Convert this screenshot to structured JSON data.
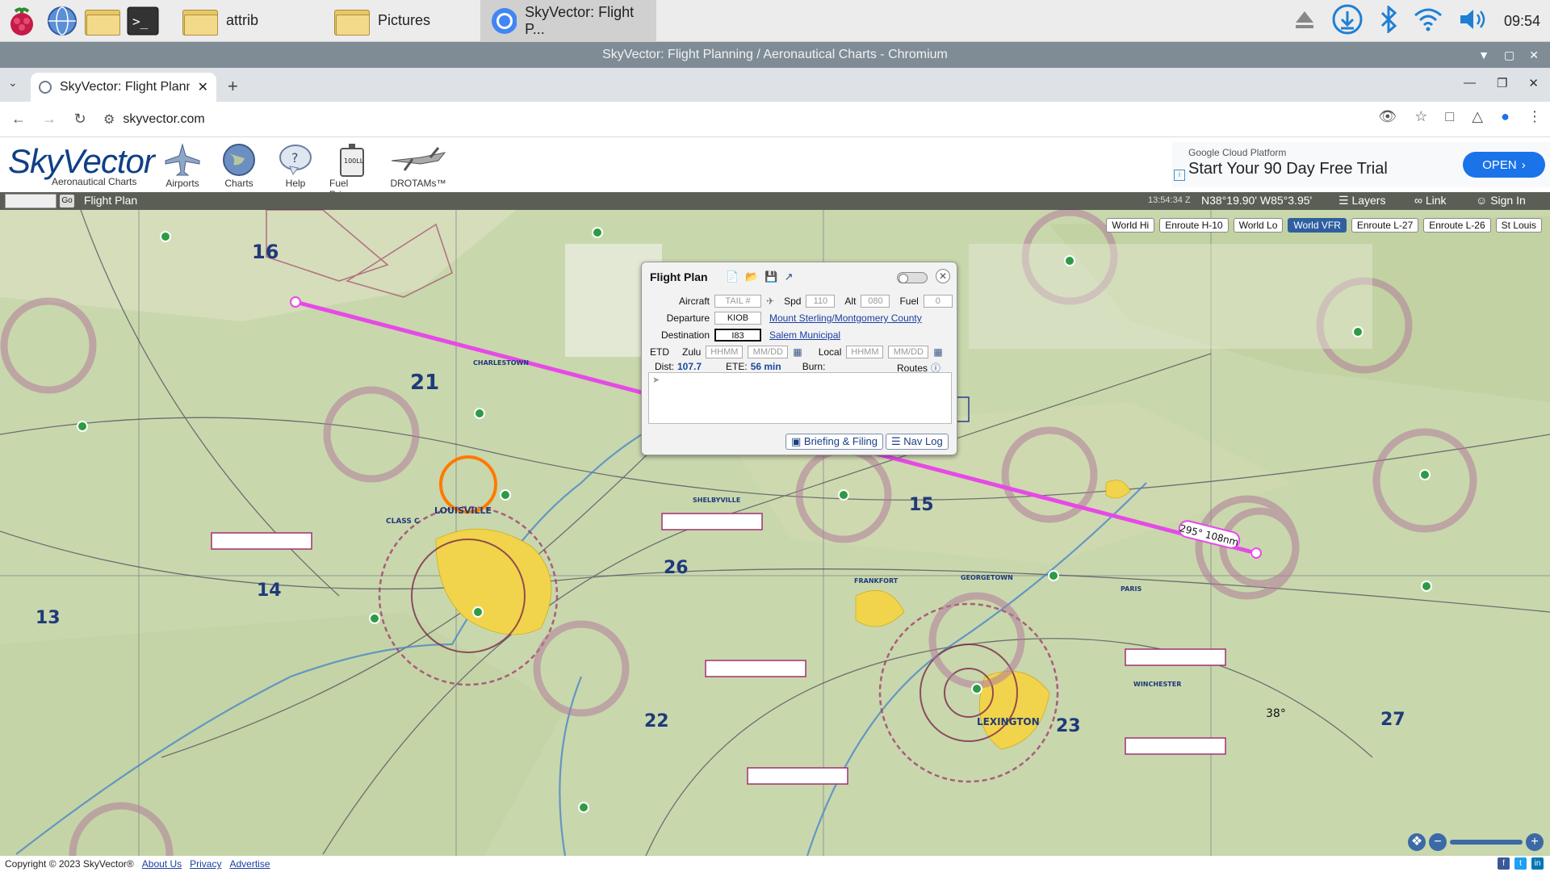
{
  "taskbar": {
    "items": [
      {
        "label": "attrib"
      },
      {
        "label": "Pictures"
      },
      {
        "label": "SkyVector: Flight P..."
      }
    ],
    "clock": "09:54"
  },
  "window": {
    "title": "SkyVector: Flight Planning / Aeronautical Charts - Chromium"
  },
  "browser": {
    "tab_title": "SkyVector: Flight Planning",
    "url": "skyvector.com"
  },
  "header": {
    "logo": "SkyVector",
    "logo_sub": "Aeronautical Charts",
    "nav": [
      "Airports",
      "Charts",
      "Help",
      "Fuel Prices",
      "DROTAMs™"
    ],
    "ad": {
      "provider": "Google Cloud Platform",
      "headline": "Start Your 90 Day Free Trial",
      "button": "OPEN"
    }
  },
  "map": {
    "go_label": "Go",
    "flight_plan_label": "Flight Plan",
    "time": "13:54:34 Z",
    "coords": "N38°19.90' W85°3.95'",
    "layers": "Layers",
    "link": "Link",
    "sign_in": "Sign In",
    "chart_tabs": [
      "World Hi",
      "Enroute H-10",
      "World Lo",
      "World VFR",
      "Enroute L-27",
      "Enroute L-26",
      "St Louis"
    ],
    "selected_chart": "World VFR",
    "route_label": "295° 108nm",
    "labels": [
      "LOUISVILLE",
      "LEXINGTON",
      "CHARLESTOWN",
      "SHELBYVILLE",
      "FRANKFORT",
      "WINCHESTER",
      "PARIS",
      "GEORGETOWN",
      "CLASS C",
      "16",
      "21",
      "14",
      "13",
      "26",
      "15",
      "22",
      "23",
      "27",
      "38°"
    ]
  },
  "flight_plan": {
    "title": "Flight Plan",
    "aircraft_label": "Aircraft",
    "tail_placeholder": "TAIL #",
    "spd_label": "Spd",
    "spd_value": "110",
    "alt_label": "Alt",
    "alt_value": "080",
    "fuel_label": "Fuel",
    "fuel_value": "0",
    "departure_label": "Departure",
    "departure_code": "KIOB",
    "departure_name": "Mount Sterling/Montgomery County",
    "destination_label": "Destination",
    "destination_code": "I83",
    "destination_name": "Salem Municipal",
    "etd_label": "ETD",
    "zulu_label": "Zulu",
    "local_label": "Local",
    "hhmm": "HHMM",
    "mmdd": "MM/DD",
    "dist_label": "Dist:",
    "dist_value": "107.7",
    "ete_label": "ETE:",
    "ete_value": "56 min",
    "burn_label": "Burn:",
    "routes_label": "Routes",
    "briefing_button": "Briefing & Filing",
    "navlog_button": "Nav Log"
  },
  "footer": {
    "copyright": "Copyright © 2023 SkyVector®",
    "links": [
      "About Us",
      "Privacy",
      "Advertise"
    ]
  },
  "colors": {
    "route": "#e64ae6",
    "map_bg": "#c9d7ad",
    "brand": "#0f3f86"
  }
}
